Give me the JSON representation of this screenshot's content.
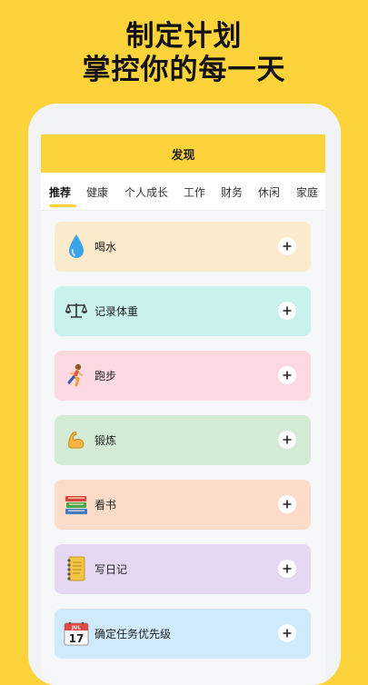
{
  "promo": {
    "line1": "制定计划",
    "line2": "掌控你的每一天"
  },
  "header": {
    "title": "发现"
  },
  "tabs": [
    {
      "label": "推荐",
      "active": true
    },
    {
      "label": "健康",
      "active": false
    },
    {
      "label": "个人成长",
      "active": false
    },
    {
      "label": "工作",
      "active": false
    },
    {
      "label": "财务",
      "active": false
    },
    {
      "label": "休闲",
      "active": false
    },
    {
      "label": "家庭",
      "active": false
    }
  ],
  "habits": [
    {
      "label": "喝水",
      "icon": "droplet-icon",
      "color": "#FBEACB"
    },
    {
      "label": "记录体重",
      "icon": "scale-icon",
      "color": "#C9F1EE"
    },
    {
      "label": "跑步",
      "icon": "runner-icon",
      "color": "#FCD9E0"
    },
    {
      "label": "锻炼",
      "icon": "flexed-biceps-icon",
      "color": "#D3EAD4"
    },
    {
      "label": "看书",
      "icon": "books-icon",
      "color": "#FCDCC9"
    },
    {
      "label": "写日记",
      "icon": "notebook-icon",
      "color": "#E6D8F2"
    },
    {
      "label": "确定任务优先级",
      "icon": "calendar-icon",
      "color": "#CFEAFA"
    }
  ],
  "calendar_icon": {
    "month": "JUL",
    "day": "17"
  },
  "colors": {
    "accent": "#FDD33C",
    "background": "#FDD33C"
  }
}
